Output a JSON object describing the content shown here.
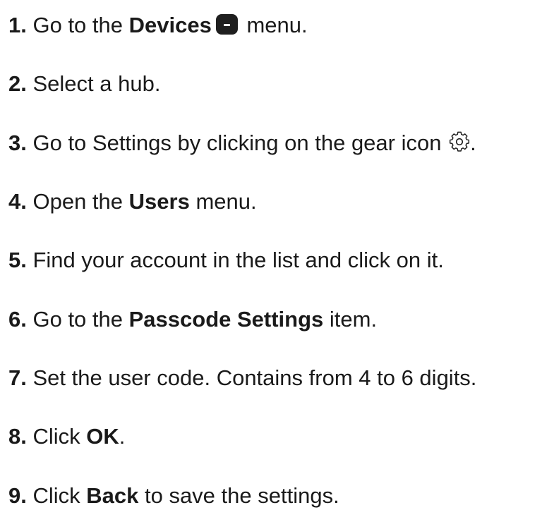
{
  "steps": [
    {
      "num": "1.",
      "pre": " Go to the ",
      "bold": "Devices",
      "post": " menu."
    },
    {
      "num": "2.",
      "text": " Select a hub."
    },
    {
      "num": "3.",
      "pre": " Go to Settings by clicking on the gear icon ",
      "post": "."
    },
    {
      "num": "4.",
      "pre": " Open the ",
      "bold": "Users",
      "post": " menu."
    },
    {
      "num": "5.",
      "text": " Find your account in the list and click on it."
    },
    {
      "num": "6.",
      "pre": " Go to the ",
      "bold": "Passcode Settings",
      "post": " item."
    },
    {
      "num": "7.",
      "text": " Set the user code. Contains from 4 to 6 digits."
    },
    {
      "num": "8.",
      "pre": " Click ",
      "bold": "OK",
      "post": "."
    },
    {
      "num": "9.",
      "pre": " Click ",
      "bold": "Back",
      "post": " to save the settings."
    }
  ],
  "icons": {
    "devices": "devices-menu-icon",
    "gear": "gear-icon"
  }
}
